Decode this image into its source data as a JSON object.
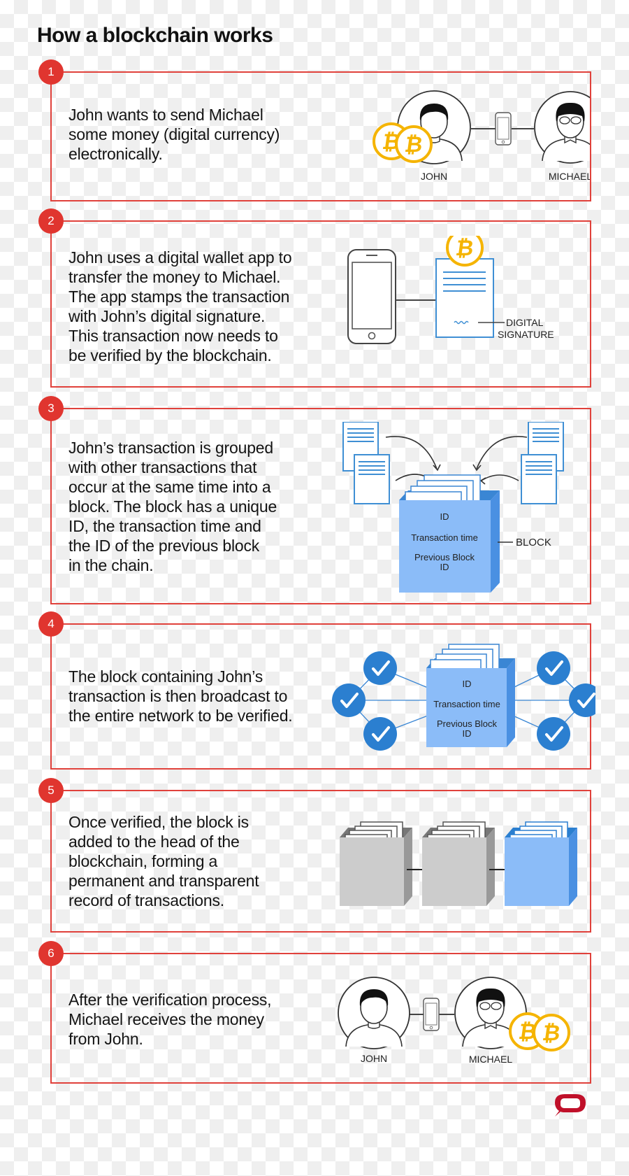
{
  "title": "How a blockchain works",
  "colors": {
    "accent_red": "#e0352f",
    "border_red": "#e0413b",
    "bitcoin_gold": "#f5b400",
    "block_blue": "#8bbcf8",
    "check_blue": "#2b7fd0",
    "logo_red": "#c0102a"
  },
  "steps": [
    {
      "number": "1",
      "text": "John wants to send Michael\nsome money (digital currency)\nelectronically.",
      "labels": {
        "john": "JOHN",
        "michael": "MICHAEL"
      }
    },
    {
      "number": "2",
      "text": "John uses a digital wallet app to\ntransfer the money to Michael.\nThe app stamps the transaction\nwith John’s digital signature.\nThis transaction now needs to\nbe verified by the blockchain.",
      "labels": {
        "signature": "DIGITAL",
        "signature2": "SIGNATURE"
      }
    },
    {
      "number": "3",
      "text": "John’s transaction is grouped\nwith other transactions that\noccur at the same time into a\nblock. The block has a unique\nID, the transaction time and\nthe ID of the previous block\nin the chain.",
      "labels": {
        "id": "ID",
        "time": "Transaction time",
        "prev": "Previous Block",
        "prev2": "ID",
        "block": "BLOCK"
      }
    },
    {
      "number": "4",
      "text": "The block containing John’s\ntransaction is then broadcast to\nthe entire network to be verified.",
      "labels": {
        "id": "ID",
        "time": "Transaction time",
        "prev": "Previous Block",
        "prev2": "ID"
      }
    },
    {
      "number": "5",
      "text": "Once verified, the block is\nadded to the head of the\nblockchain, forming a\npermanent and transparent\nrecord of transactions."
    },
    {
      "number": "6",
      "text": "After the verification process,\nMichael receives the money\nfrom John.",
      "labels": {
        "john": "JOHN",
        "michael": "MICHAEL"
      }
    }
  ],
  "icons": {
    "bitcoin": "bitcoin-coin-icon",
    "phone": "smartphone-icon",
    "person": "person-avatar-icon",
    "check": "checkmark-icon",
    "block": "block-cube-icon",
    "document": "document-icon",
    "logo": "speech-bubble-logo-icon"
  }
}
